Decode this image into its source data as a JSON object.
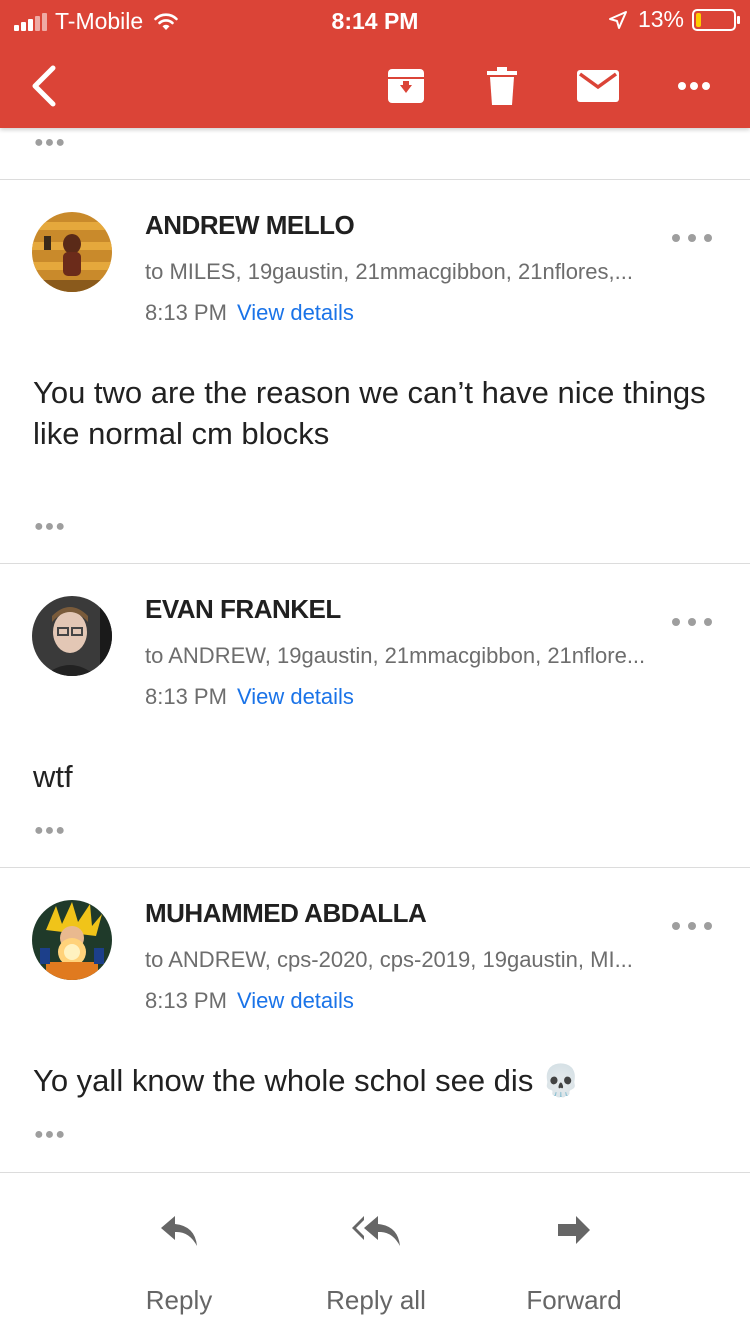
{
  "status_bar": {
    "carrier": "T-Mobile",
    "time": "8:14 PM",
    "battery": "13%"
  },
  "header": {
    "back_icon": "chevron-left-icon",
    "archive_icon": "archive-icon",
    "delete_icon": "trash-icon",
    "mark_unread_icon": "mail-icon",
    "more_icon": "more-horizontal-icon",
    "accent_color": "#db4437"
  },
  "messages": [
    {
      "sender": "ANDREW MELLO",
      "recipients": "to MILES, 19gaustin, 21mmacgibbon, 21nflores,...",
      "time": "8:13 PM",
      "details_link": "View details",
      "body": "You two are the reason we can’t have nice things like normal cm blocks"
    },
    {
      "sender": "EVAN FRANKEL",
      "recipients": "to ANDREW, 19gaustin, 21mmacgibbon, 21nflore...",
      "time": "8:13 PM",
      "details_link": "View details",
      "body": "wtf"
    },
    {
      "sender": "MUHAMMED ABDALLA",
      "recipients": "to ANDREW, cps-2020, cps-2019, 19gaustin, MI...",
      "time": "8:13 PM",
      "details_link": "View details",
      "body": "Yo yall know the whole schol see dis 💀"
    }
  ],
  "actions": {
    "reply": "Reply",
    "reply_all": "Reply all",
    "forward": "Forward"
  }
}
